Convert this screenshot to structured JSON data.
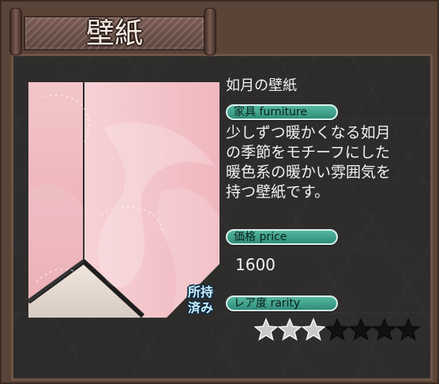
{
  "header": {
    "title": "壁紙"
  },
  "item": {
    "name": "如月の壁紙",
    "type_label": "家具 furniture",
    "description_lines": [
      "少しずつ暖かくなる如月",
      "の季節をモチーフにした",
      "暖色系の暖かい雰囲気を",
      "持つ壁紙です。"
    ],
    "price_label": "価格 price",
    "price": "1600",
    "rarity_label": "レア度 rarity",
    "rarity": {
      "value": 3,
      "max": 7
    },
    "owned_badge": [
      "所持",
      "済み"
    ]
  },
  "icons": {
    "star_filled": "star-filled-icon",
    "star_empty": "star-empty-icon"
  },
  "colors": {
    "pill_bg": "#2f8d7a",
    "text": "#f2f2f2",
    "owned_text": "#c9f1ff"
  }
}
